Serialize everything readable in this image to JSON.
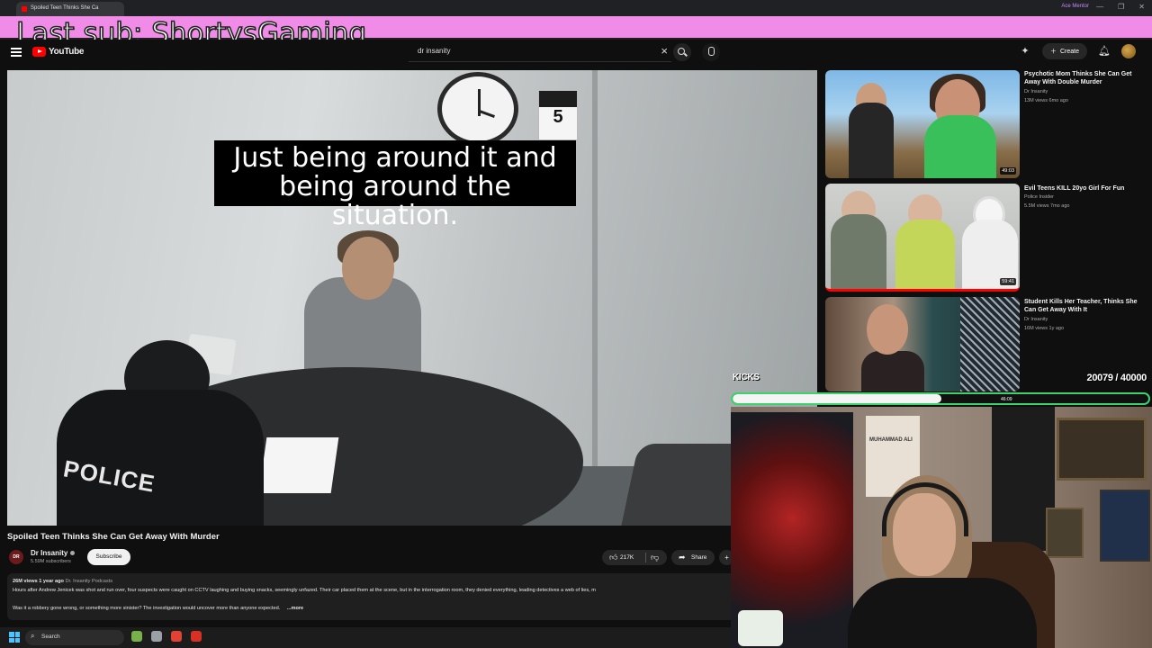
{
  "browser": {
    "tab_title": "Spoiled Teen Thinks She Ca",
    "profile": "Ace Mentor",
    "window_controls": [
      "—",
      "❐",
      "✕"
    ]
  },
  "overlay": {
    "last_sub": "Last sub: ShortysGaming",
    "goal_label": "KICKS",
    "goal_count": "20079 / 40000",
    "goal_progress": 0.502,
    "goal_time": "46:09"
  },
  "header": {
    "logo_text": "YouTube",
    "search_value": "dr insanity",
    "create_label": "Create"
  },
  "player": {
    "caption": "Just being around it and\nbeing around the situation.",
    "police_text": "POLICE",
    "calendar_day": "5"
  },
  "video": {
    "title": "Spoiled Teen Thinks She Can Get Away With Murder",
    "channel": "Dr Insanity",
    "subscribers": "5.59M subscribers",
    "subscribe_label": "Subscribe",
    "likes": "217K",
    "share_label": "Share",
    "more_glyph": "+"
  },
  "description": {
    "meta": "26M views  1 year ago",
    "tag": "Dr. Insanity Podcasts",
    "line1": "Hours after Andrew Jenicek was shot and run over, four suspects were caught on CCTV laughing and buying snacks, seemingly unfazed. Their car placed them at the scene, but in the interrogation room, they denied everything, leading detectives a web of lies, m",
    "line2": "Was it a robbery gone wrong, or something more sinister? The investigation would uncover more than anyone expected.",
    "more": "...more"
  },
  "recommendations": [
    {
      "title": "Psychotic Mom Thinks She Can Get Away With Double Murder",
      "channel": "Dr Insanity",
      "meta": "13M views  6mo ago",
      "duration": "49:03"
    },
    {
      "title": "Evil Teens KILL 20yo Girl For Fun",
      "channel": "Police Insider",
      "meta": "5.5M views  7mo ago",
      "duration": "59:41"
    },
    {
      "title": "Student Kills Her Teacher, Thinks She Can Get Away With It",
      "channel": "Dr Insanity",
      "meta": "16M views  1y ago",
      "duration": ""
    }
  ],
  "webcam": {
    "poster_text": "MUHAMMAD ALI"
  },
  "taskbar": {
    "search_label": "Search",
    "apps": [
      "#78b04a",
      "#9aa0a6",
      "#e34133",
      "#d93025"
    ]
  }
}
